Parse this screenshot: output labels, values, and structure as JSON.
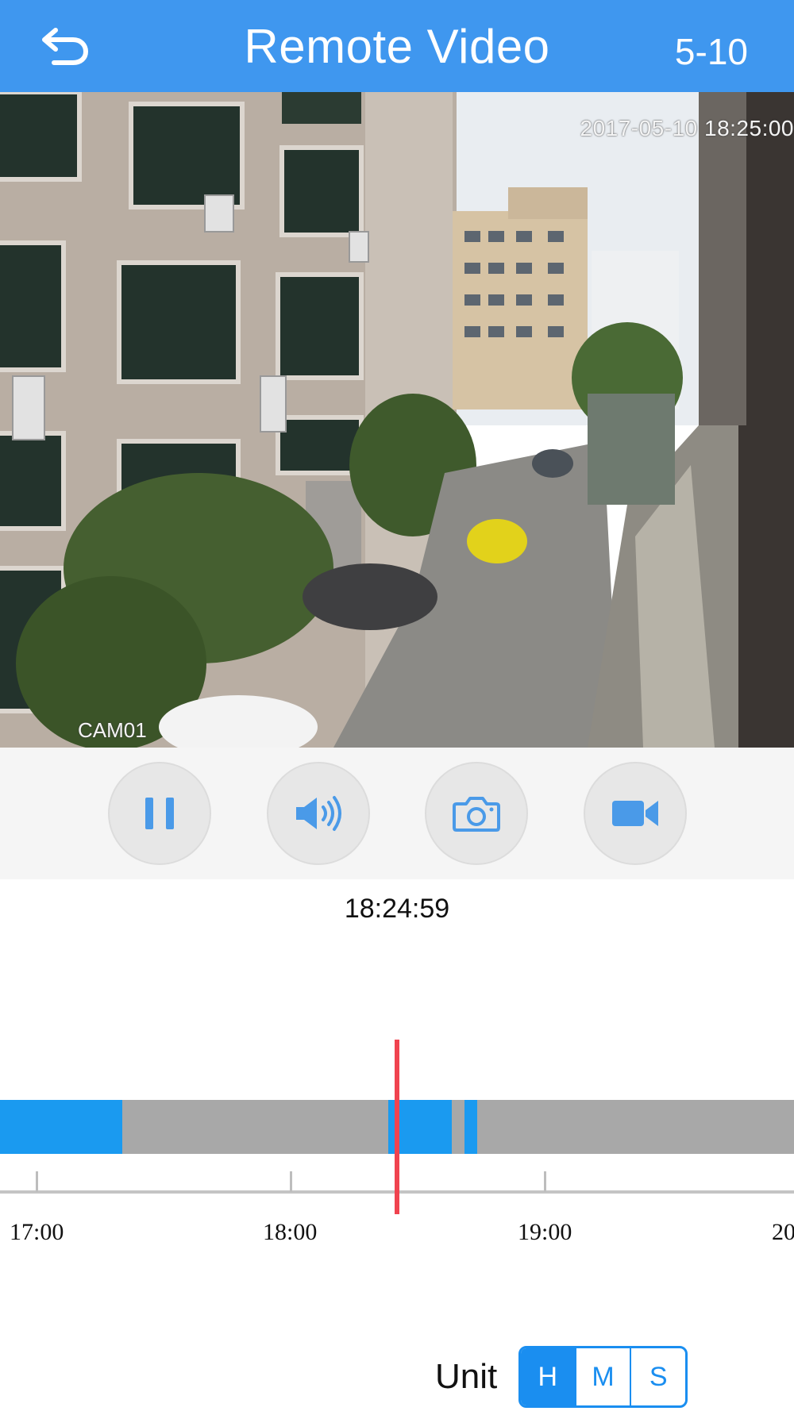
{
  "header": {
    "title": "Remote Video",
    "date_label": "5-10",
    "back_icon": "back-arrow-icon"
  },
  "video": {
    "osd_timestamp": "2017-05-10 18:25:00",
    "camera_label": "CAM01"
  },
  "controls": [
    {
      "name": "pause",
      "icon": "pause-icon"
    },
    {
      "name": "audio",
      "icon": "speaker-icon"
    },
    {
      "name": "snapshot",
      "icon": "camera-icon"
    },
    {
      "name": "record",
      "icon": "video-camera-icon"
    }
  ],
  "timeline": {
    "current_time": "18:24:59",
    "tick_labels": [
      "17:00",
      "18:00",
      "19:00",
      "20"
    ],
    "recorded_segments": [
      {
        "start": "16:55",
        "end": "17:20"
      },
      {
        "start": "18:23",
        "end": "18:38"
      },
      {
        "start": "18:41",
        "end": "18:44"
      }
    ],
    "colors": {
      "recorded": "#1a9af0",
      "empty": "#a8a8a8",
      "playhead": "#f0434f"
    }
  },
  "unit_selector": {
    "label": "Unit",
    "options": [
      "H",
      "M",
      "S"
    ],
    "selected": "H"
  },
  "colors": {
    "accent": "#3f97ef"
  }
}
